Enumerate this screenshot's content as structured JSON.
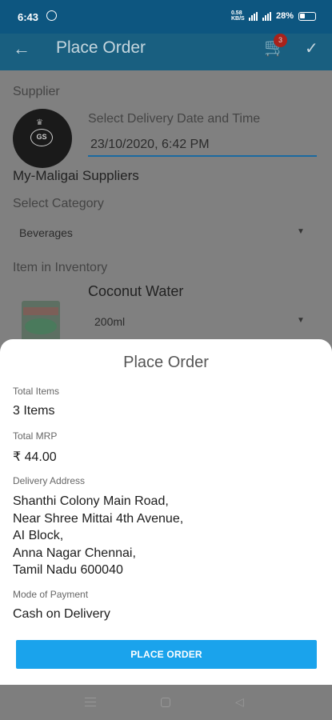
{
  "status_bar": {
    "time": "6:43",
    "net_speed": "0.58 KB/S",
    "battery": "28%"
  },
  "app_bar": {
    "back_icon": "arrow-left-icon",
    "title": "Place Order",
    "cart_icon": "cart-icon",
    "cart_count": "3",
    "confirm_icon": "check-icon"
  },
  "form": {
    "supplier_label": "Supplier",
    "supplier_logo_text": "GS",
    "delivery_label": "Select Delivery Date and Time",
    "delivery_value": "23/10/2020, 6:42 PM",
    "supplier_name": "My-Maligai Suppliers",
    "category_label": "Select Category",
    "category_value": "Beverages",
    "inventory_label": "Item in Inventory",
    "product_name": "Coconut Water",
    "product_size": "200ml"
  },
  "sheet": {
    "title": "Place Order",
    "total_items_label": "Total Items",
    "total_items_value": "3 Items",
    "total_mrp_label": "Total MRP",
    "total_mrp_value": "₹ 44.00",
    "address_label": "Delivery Address",
    "address_lines": [
      "Shanthi Colony Main Road,",
      "Near Shree Mittai 4th Avenue,",
      "AI Block,",
      "Anna Nagar Chennai,",
      "Tamil Nadu 600040"
    ],
    "payment_label": "Mode of Payment",
    "payment_value": "Cash on Delivery",
    "button_label": "PLACE ORDER"
  },
  "colors": {
    "app_bar": "#195f80",
    "status_bar": "#0d5680",
    "button": "#1aa3ec",
    "scrim": "#808080",
    "badge": "#a8221b"
  }
}
